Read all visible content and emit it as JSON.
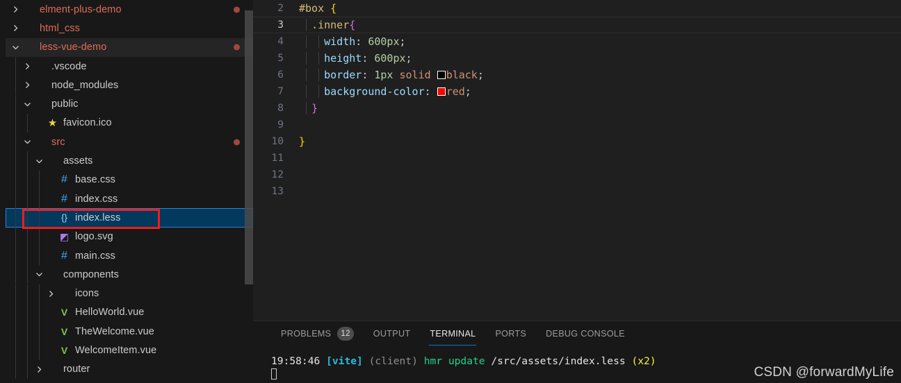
{
  "explorer": {
    "rows": [
      {
        "label": "elment-plus-demo",
        "kind": "root-collapsed",
        "indent": 0,
        "twisty": "chevron-right-icon",
        "icon": "",
        "modified": true,
        "state": "normal",
        "name": "tree-item-elment-plus-demo"
      },
      {
        "label": "html_css",
        "kind": "root-collapsed",
        "indent": 0,
        "twisty": "chevron-right-icon",
        "icon": "",
        "modified": false,
        "state": "normal",
        "name": "tree-item-html-css"
      },
      {
        "label": "less-vue-demo",
        "kind": "root-expanded",
        "indent": 0,
        "twisty": "chevron-down-icon",
        "icon": "",
        "modified": true,
        "state": "active",
        "name": "tree-item-less-vue-demo"
      },
      {
        "label": ".vscode",
        "kind": "folder",
        "indent": 1,
        "twisty": "chevron-right-icon",
        "icon": "",
        "modified": false,
        "state": "normal",
        "name": "tree-item-vscode"
      },
      {
        "label": "node_modules",
        "kind": "folder",
        "indent": 1,
        "twisty": "chevron-right-icon",
        "icon": "",
        "modified": false,
        "state": "normal",
        "name": "tree-item-node-modules"
      },
      {
        "label": "public",
        "kind": "folder",
        "indent": 1,
        "twisty": "chevron-down-icon",
        "icon": "",
        "modified": false,
        "state": "normal",
        "name": "tree-item-public"
      },
      {
        "label": "favicon.ico",
        "kind": "file-star",
        "indent": 2,
        "twisty": "",
        "icon": "star-icon",
        "modified": false,
        "state": "normal",
        "name": "tree-item-favicon-ico"
      },
      {
        "label": "src",
        "kind": "folder-red",
        "indent": 1,
        "twisty": "chevron-down-icon",
        "icon": "",
        "modified": true,
        "state": "normal",
        "name": "tree-item-src"
      },
      {
        "label": "assets",
        "kind": "folder",
        "indent": 2,
        "twisty": "chevron-down-icon",
        "icon": "",
        "modified": false,
        "state": "normal",
        "name": "tree-item-assets"
      },
      {
        "label": "base.css",
        "kind": "file-css",
        "indent": 3,
        "twisty": "",
        "icon": "hash-icon",
        "modified": false,
        "state": "normal",
        "name": "tree-item-base-css"
      },
      {
        "label": "index.css",
        "kind": "file-css",
        "indent": 3,
        "twisty": "",
        "icon": "hash-icon",
        "modified": false,
        "state": "normal",
        "name": "tree-item-index-css"
      },
      {
        "label": "index.less",
        "kind": "file-less",
        "indent": 3,
        "twisty": "",
        "icon": "braces-icon",
        "modified": false,
        "state": "selected",
        "name": "tree-item-index-less"
      },
      {
        "label": "logo.svg",
        "kind": "file-svg",
        "indent": 3,
        "twisty": "",
        "icon": "svg-icon",
        "modified": false,
        "state": "normal",
        "name": "tree-item-logo-svg"
      },
      {
        "label": "main.css",
        "kind": "file-css",
        "indent": 3,
        "twisty": "",
        "icon": "hash-icon",
        "modified": false,
        "state": "normal",
        "name": "tree-item-main-css"
      },
      {
        "label": "components",
        "kind": "folder",
        "indent": 2,
        "twisty": "chevron-down-icon",
        "icon": "",
        "modified": false,
        "state": "normal",
        "name": "tree-item-components"
      },
      {
        "label": "icons",
        "kind": "folder",
        "indent": 3,
        "twisty": "chevron-right-icon",
        "icon": "",
        "modified": false,
        "state": "normal",
        "name": "tree-item-icons"
      },
      {
        "label": "HelloWorld.vue",
        "kind": "file-vue",
        "indent": 3,
        "twisty": "",
        "icon": "vue-icon",
        "modified": false,
        "state": "normal",
        "name": "tree-item-helloworld-vue"
      },
      {
        "label": "TheWelcome.vue",
        "kind": "file-vue",
        "indent": 3,
        "twisty": "",
        "icon": "vue-icon",
        "modified": false,
        "state": "normal",
        "name": "tree-item-thewelcome-vue"
      },
      {
        "label": "WelcomeItem.vue",
        "kind": "file-vue",
        "indent": 3,
        "twisty": "",
        "icon": "vue-icon",
        "modified": false,
        "state": "normal",
        "name": "tree-item-welcomeitem-vue"
      },
      {
        "label": "router",
        "kind": "folder",
        "indent": 2,
        "twisty": "chevron-right-icon",
        "icon": "",
        "modified": false,
        "state": "normal",
        "name": "tree-item-router"
      }
    ],
    "annotation": {
      "color": "#ef1d1d",
      "target": "index.less"
    }
  },
  "editor": {
    "first_line_number": 2,
    "current_line_number": 3,
    "lines": [
      {
        "n": "2",
        "segments": [
          {
            "t": "#box ",
            "c": "t-sel"
          },
          {
            "t": "{",
            "c": "t-brace-y"
          }
        ],
        "indent_guides": 0
      },
      {
        "n": "3",
        "segments": [
          {
            "t": "  ",
            "c": "t-punc"
          },
          {
            "t": ".inner",
            "c": "t-class"
          },
          {
            "t": "{",
            "c": "t-brace-p"
          }
        ],
        "indent_guides": 1
      },
      {
        "n": "4",
        "segments": [
          {
            "t": "    ",
            "c": "t-punc"
          },
          {
            "t": "width",
            "c": "t-prop"
          },
          {
            "t": ": ",
            "c": "t-punc"
          },
          {
            "t": "600px",
            "c": "t-num"
          },
          {
            "t": ";",
            "c": "t-punc"
          }
        ],
        "indent_guides": 2
      },
      {
        "n": "5",
        "segments": [
          {
            "t": "    ",
            "c": "t-punc"
          },
          {
            "t": "height",
            "c": "t-prop"
          },
          {
            "t": ": ",
            "c": "t-punc"
          },
          {
            "t": "600px",
            "c": "t-num"
          },
          {
            "t": ";",
            "c": "t-punc"
          }
        ],
        "indent_guides": 2
      },
      {
        "n": "6",
        "segments": [
          {
            "t": "    ",
            "c": "t-punc"
          },
          {
            "t": "border",
            "c": "t-prop"
          },
          {
            "t": ": ",
            "c": "t-punc"
          },
          {
            "t": "1px",
            "c": "t-num"
          },
          {
            "t": " ",
            "c": "t-punc"
          },
          {
            "t": "solid",
            "c": "t-str"
          },
          {
            "t": " ",
            "c": "t-punc"
          },
          {
            "swatch": "#000000"
          },
          {
            "t": "black",
            "c": "t-str"
          },
          {
            "t": ";",
            "c": "t-punc"
          }
        ],
        "indent_guides": 2
      },
      {
        "n": "7",
        "segments": [
          {
            "t": "    ",
            "c": "t-punc"
          },
          {
            "t": "background-color",
            "c": "t-prop"
          },
          {
            "t": ": ",
            "c": "t-punc"
          },
          {
            "swatch": "#ff0000"
          },
          {
            "t": "red",
            "c": "t-str"
          },
          {
            "t": ";",
            "c": "t-punc"
          }
        ],
        "indent_guides": 2
      },
      {
        "n": "8",
        "segments": [
          {
            "t": "  ",
            "c": "t-punc"
          },
          {
            "t": "}",
            "c": "t-brace-p"
          }
        ],
        "indent_guides": 1
      },
      {
        "n": "9",
        "segments": [],
        "indent_guides": 1
      },
      {
        "n": "10",
        "segments": [
          {
            "t": "}",
            "c": "t-brace-y"
          }
        ],
        "indent_guides": 0
      },
      {
        "n": "11",
        "segments": [],
        "indent_guides": 0
      },
      {
        "n": "12",
        "segments": [],
        "indent_guides": 0
      },
      {
        "n": "13",
        "segments": [],
        "indent_guides": 0
      }
    ]
  },
  "panel": {
    "tabs": [
      {
        "label": "PROBLEMS",
        "badge": "12",
        "active": false,
        "name": "tab-problems"
      },
      {
        "label": "OUTPUT",
        "badge": "",
        "active": false,
        "name": "tab-output"
      },
      {
        "label": "TERMINAL",
        "badge": "",
        "active": true,
        "name": "tab-terminal"
      },
      {
        "label": "PORTS",
        "badge": "",
        "active": false,
        "name": "tab-ports"
      },
      {
        "label": "DEBUG CONSOLE",
        "badge": "",
        "active": false,
        "name": "tab-debug-console"
      }
    ],
    "terminal": {
      "time": "19:58:46",
      "tag": "[vite]",
      "scope": "(client)",
      "action": "hmr update",
      "path": "/src/assets/index.less",
      "count": "(x2)"
    }
  },
  "watermark": {
    "text": "CSDN @forwardMyLife"
  },
  "colors": {
    "sidebar_bg": "#181818",
    "editor_bg": "#1f1f1f",
    "selection_bg": "#04395e",
    "selection_border": "#2f80d2",
    "annotation_red": "#ef1d1d",
    "accent_blue": "#0078d4",
    "folder_red": "#e06c5a",
    "modified_dot": "#a1483d"
  }
}
